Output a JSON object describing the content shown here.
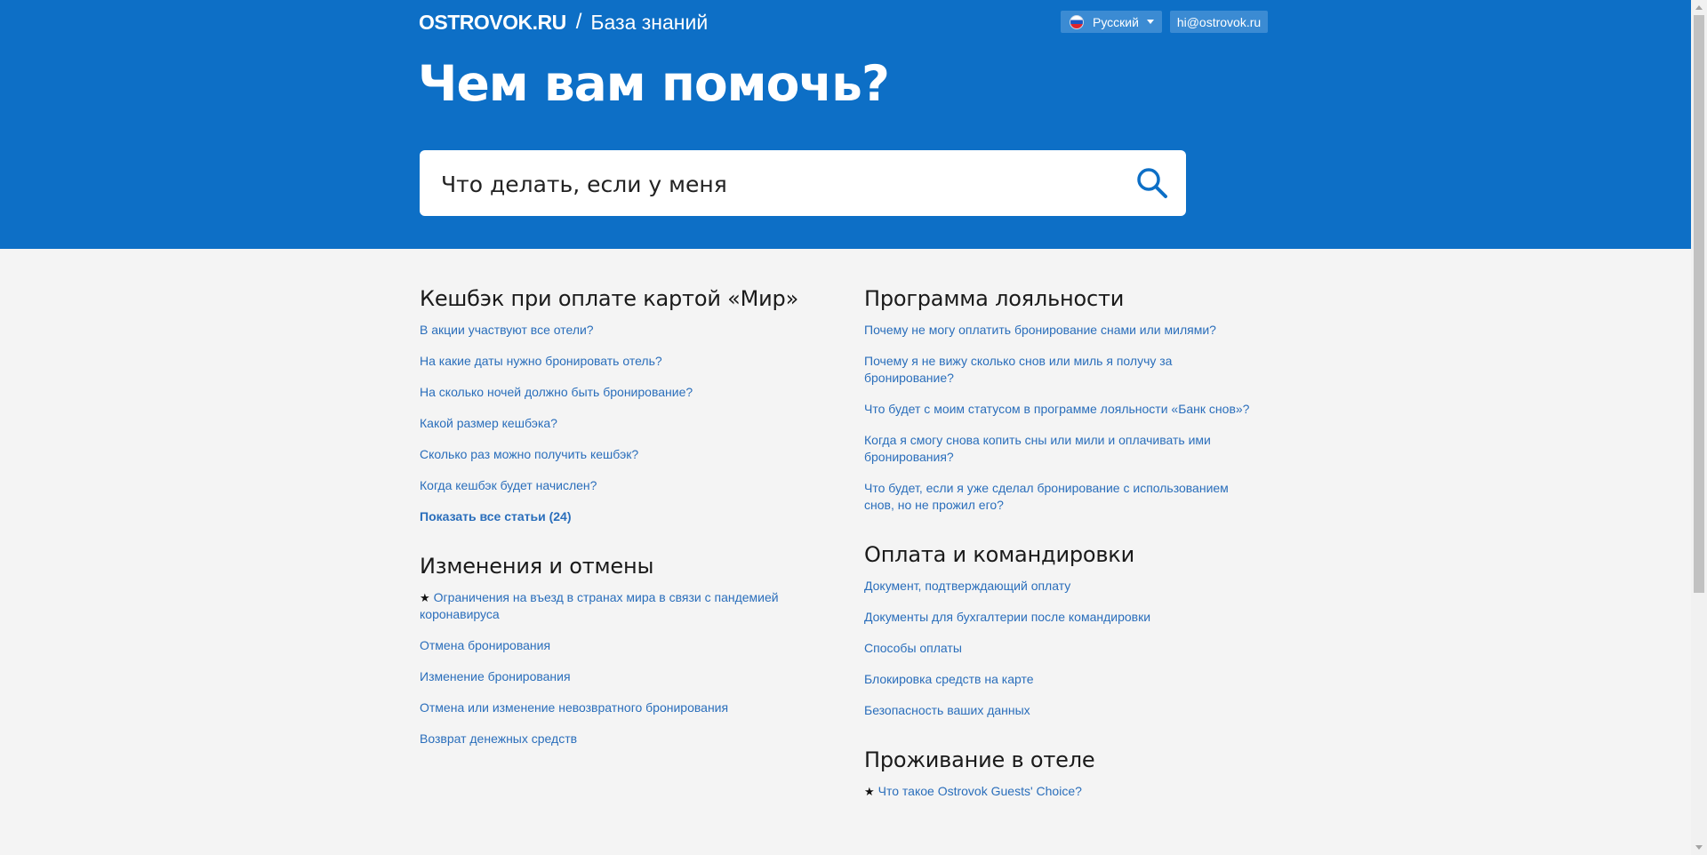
{
  "header": {
    "logo": "OSTROVOK.RU",
    "separator": "/",
    "subtitle": "База знаний",
    "language": "Русский",
    "email": "hi@ostrovok.ru"
  },
  "hero": {
    "title": "Чем вам помочь?"
  },
  "search": {
    "value": "Что делать, если у меня"
  },
  "left_sections": [
    {
      "title": "Кешбэк при оплате картой «Мир»",
      "items": [
        "В акции участвуют все отели?",
        "На какие даты нужно бронировать отель?",
        "На сколько ночей должно быть бронирование?",
        "Какой размер кешбэка?",
        "Сколько раз можно получить кешбэк?",
        "Когда кешбэк будет начислен?"
      ],
      "show_all": "Показать все статьи (24)"
    },
    {
      "title": "Изменения и отмены",
      "starred_item": "Ограничения на въезд в странах мира в связи с пандемией коронавируса",
      "items": [
        "Отмена бронирования",
        "Изменение бронирования",
        "Отмена или изменение невозвратного бронирования",
        "Возврат денежных средств"
      ]
    }
  ],
  "right_sections": [
    {
      "title": "Программа лояльности",
      "items": [
        "Почему не могу оплатить бронирование снами или милями?",
        "Почему я не вижу сколько снов или миль я получу за бронирование?",
        "Что будет с моим статусом в программе лояльности «Банк снов»?",
        "Когда я смогу снова копить сны или мили и оплачивать ими бронирования?",
        "Что будет, если я уже сделал бронирование с использованием снов, но не прожил его?"
      ]
    },
    {
      "title": "Оплата и командировки",
      "items": [
        "Документ, подтверждающий оплату",
        "Документы для бухгалтерии после командировки",
        "Способы оплаты",
        "Блокировка средств на карте",
        "Безопасность ваших данных"
      ]
    },
    {
      "title": "Проживание в отеле",
      "starred_item": "Что такое Ostrovok Guests' Choice?"
    }
  ],
  "icons": {
    "search": "search-icon",
    "flag": "russia-flag-icon",
    "caret": "caret-down-icon",
    "star": "star-icon"
  },
  "colors": {
    "brand_blue": "#0d6fc6",
    "link": "#2a6ebb",
    "background": "#f4f4f4"
  }
}
